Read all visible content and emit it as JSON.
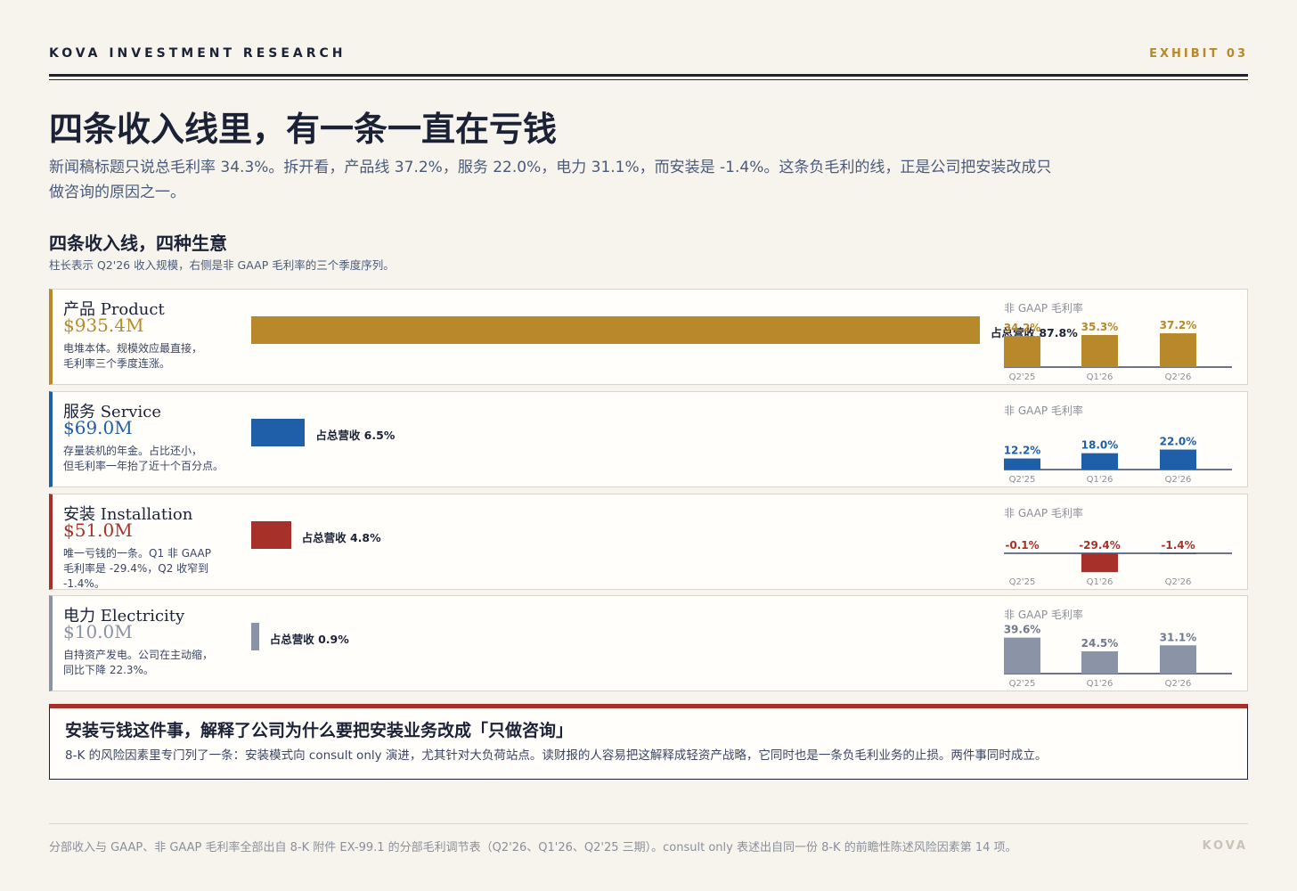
{
  "header": {
    "brand": "KOVA INVESTMENT RESEARCH",
    "exhibit": "EXHIBIT 03"
  },
  "title": "四条收入线里，有一条一直在亏钱",
  "lede": "新闻稿标题只说总毛利率 34.3%。拆开看，产品线 37.2%，服务 22.0%，电力 31.1%，而安装是 -1.4%。这条负毛利的线，正是公司把安装改成只做咨询的原因之一。",
  "section": {
    "title": "四条收入线，四种生意",
    "subtitle": "柱长表示 Q2'26 收入规模，右侧是非 GAAP 毛利率的三个季度序列。"
  },
  "chart_data": {
    "type": "bar",
    "revenue_series": {
      "categories": [
        "产品 Product",
        "服务 Service",
        "安装 Installation",
        "电力 Electricity"
      ],
      "values": [
        935.4,
        69.0,
        51.0,
        10.0
      ],
      "value_labels": [
        "$935.4M",
        "$69.0M",
        "$51.0M",
        "$10.0M"
      ],
      "share_labels": [
        "占总营收 87.8%",
        "占总营收 6.5%",
        "占总营收 4.8%",
        "占总营收 0.9%"
      ],
      "share_values": [
        87.8,
        6.5,
        4.8,
        0.9
      ]
    },
    "margin_series": {
      "label": "非 GAAP 毛利率",
      "x": [
        "Q2'25",
        "Q1'26",
        "Q2'26"
      ],
      "ylim": [
        -30,
        40
      ],
      "series": [
        {
          "name": "产品 Product",
          "values": [
            34.2,
            35.3,
            37.2
          ],
          "labels": [
            "34.2%",
            "35.3%",
            "37.2%"
          ]
        },
        {
          "name": "服务 Service",
          "values": [
            12.2,
            18.0,
            22.0
          ],
          "labels": [
            "12.2%",
            "18.0%",
            "22.0%"
          ]
        },
        {
          "name": "安装 Installation",
          "values": [
            -0.1,
            -29.4,
            -1.4
          ],
          "labels": [
            "-0.1%",
            "-29.4%",
            "-1.4%"
          ]
        },
        {
          "name": "电力 Electricity",
          "values": [
            39.6,
            24.5,
            31.1
          ],
          "labels": [
            "39.6%",
            "24.5%",
            "31.1%"
          ]
        }
      ]
    }
  },
  "rows": [
    {
      "name": "产品 Product",
      "value": "$935.4M",
      "color": "#b8892a",
      "desc1": "电堆本体。规模效应最直接，",
      "desc2": "毛利率三个季度连涨。"
    },
    {
      "name": "服务 Service",
      "value": "$69.0M",
      "color": "#1f5ea8",
      "desc1": "存量装机的年金。占比还小，",
      "desc2": "但毛利率一年抬了近十个百分点。"
    },
    {
      "name": "安装 Installation",
      "value": "$51.0M",
      "color": "#a8302a",
      "desc1": "唯一亏钱的一条。Q1 非 GAAP",
      "desc2": "毛利率是 -29.4%，Q2 收窄到 -1.4%。"
    },
    {
      "name": "电力 Electricity",
      "value": "$10.0M",
      "color": "#8a94a6",
      "desc1": "自持资产发电。公司在主动缩，",
      "desc2": "同比下降 22.3%。"
    }
  ],
  "callout": {
    "title": "安装亏钱这件事，解释了公司为什么要把安装业务改成「只做咨询」",
    "body": "8-K 的风险因素里专门列了一条：安装模式向 consult only 演进，尤其针对大负荷站点。读财报的人容易把这解释成轻资产战略，它同时也是一条负毛利业务的止损。两件事同时成立。"
  },
  "footer": {
    "note": "分部收入与 GAAP、非 GAAP 毛利率全部出自 8-K 附件 EX-99.1 的分部毛利调节表（Q2'26、Q1'26、Q2'25 三期）。consult only 表述出自同一份 8-K 的前瞻性陈述风险因素第 14 项。",
    "brand": "KOVA"
  }
}
